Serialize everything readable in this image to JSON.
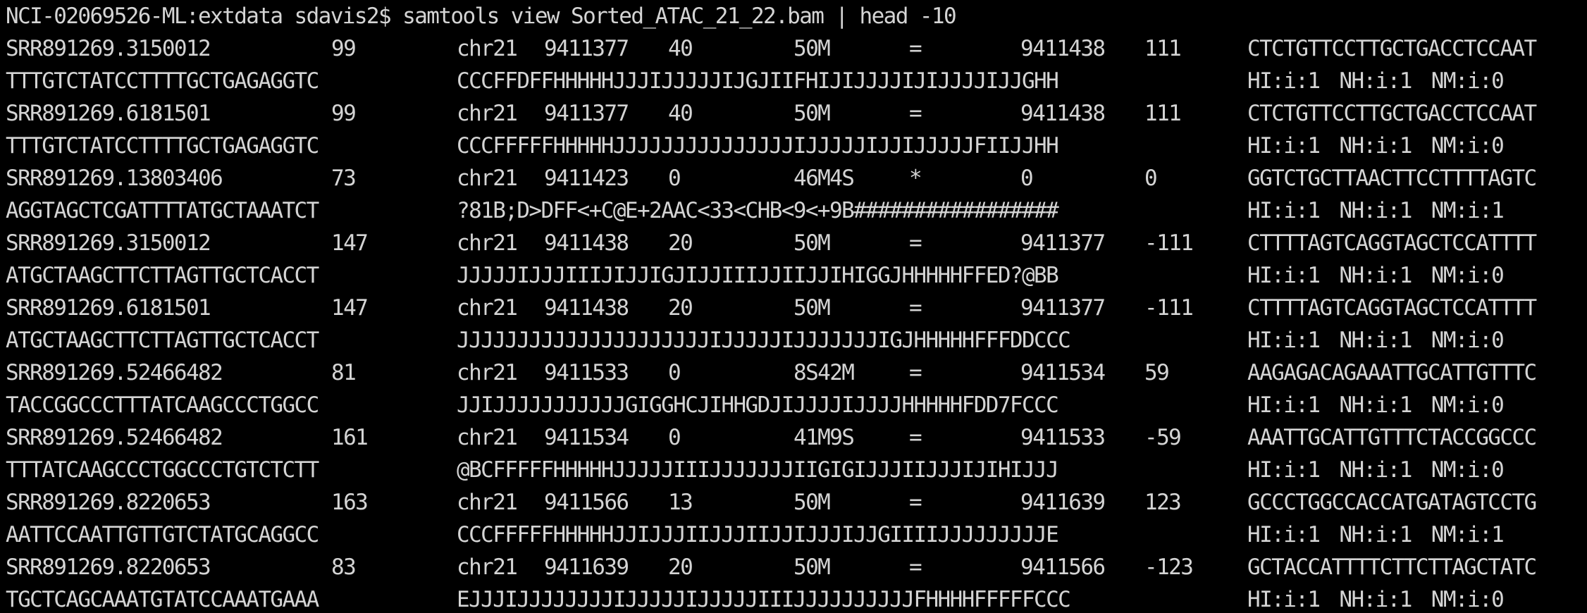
{
  "terminal": {
    "prompt": "NCI-02069526-ML:extdata sdavis2$",
    "command": "samtools view Sorted_ATAC_21_22.bam | head -10",
    "colors": {
      "background": "#000000",
      "text": "#d4d4d4"
    }
  },
  "records": [
    {
      "qname": "SRR891269.3150012",
      "flag": "99",
      "rname": "chr21",
      "pos": "9411377",
      "mapq": "40",
      "cigar": "50M",
      "rnext": "=",
      "pnext": "9411438",
      "tlen": "111",
      "seq_part1": "CTCTGTTCCTTGCTGACCTCCAAT",
      "seq_part2": "TTTGTCTATCCTTTTGCTGAGAGGTC",
      "qual": "CCCFFDFFHHHHHJJJIJJJJJIJGJIIFHIJIJJJJIJIJJJJIJJGHH",
      "tags": [
        "HI:i:1",
        "NH:i:1",
        "NM:i:0"
      ]
    },
    {
      "qname": "SRR891269.6181501",
      "flag": "99",
      "rname": "chr21",
      "pos": "9411377",
      "mapq": "40",
      "cigar": "50M",
      "rnext": "=",
      "pnext": "9411438",
      "tlen": "111",
      "seq_part1": "CTCTGTTCCTTGCTGACCTCCAAT",
      "seq_part2": "TTTGTCTATCCTTTTGCTGAGAGGTC",
      "qual": "CCCFFFFFHHHHHJJJJJJJJJJJJJJJIJJJJJIJJIJJJJJFIIJJHH",
      "tags": [
        "HI:i:1",
        "NH:i:1",
        "NM:i:0"
      ]
    },
    {
      "qname": "SRR891269.13803406",
      "flag": "73",
      "rname": "chr21",
      "pos": "9411423",
      "mapq": "0",
      "cigar": "46M4S",
      "rnext": "*",
      "pnext": "0",
      "tlen": "0",
      "seq_part1": "GGTCTGCTTAACTTCCTTTTAGTC",
      "seq_part2": "AGGTAGCTCGATTTTATGCTAAATCT",
      "qual": "?81B;D>DFF<+C@E+2AAC<33<CHB<9<+9B#################",
      "tags": [
        "HI:i:1",
        "NH:i:1",
        "NM:i:1"
      ]
    },
    {
      "qname": "SRR891269.3150012",
      "flag": "147",
      "rname": "chr21",
      "pos": "9411438",
      "mapq": "20",
      "cigar": "50M",
      "rnext": "=",
      "pnext": "9411377",
      "tlen": "-111",
      "seq_part1": "CTTTTAGTCAGGTAGCTCCATTTT",
      "seq_part2": "ATGCTAAGCTTCTTAGTTGCTCACCT",
      "qual": "JJJJJIJJJIIIJIJJIGJIJJIIIJJIIJJIHIGGJHHHHHFFED?@BB",
      "tags": [
        "HI:i:1",
        "NH:i:1",
        "NM:i:0"
      ]
    },
    {
      "qname": "SRR891269.6181501",
      "flag": "147",
      "rname": "chr21",
      "pos": "9411438",
      "mapq": "20",
      "cigar": "50M",
      "rnext": "=",
      "pnext": "9411377",
      "tlen": "-111",
      "seq_part1": "CTTTTAGTCAGGTAGCTCCATTTT",
      "seq_part2": "ATGCTAAGCTTCTTAGTTGCTCACCT",
      "qual": "JJJJJJJJJJJJJJJJJJJJJIJJJJJIJJJJJJJIGJHHHHHFFFDDCCC",
      "tags": [
        "HI:i:1",
        "NH:i:1",
        "NM:i:0"
      ]
    },
    {
      "qname": "SRR891269.52466482",
      "flag": "81",
      "rname": "chr21",
      "pos": "9411533",
      "mapq": "0",
      "cigar": "8S42M",
      "rnext": "=",
      "pnext": "9411534",
      "tlen": "59",
      "seq_part1": "AAGAGACAGAAATTGCATTGTTTC",
      "seq_part2": "TACCGGCCCTTTATCAAGCCCTGGCC",
      "qual": "JJIJJJJJJJJJJJGIGGHCJIHHGDJIJJJJIJJJJHHHHHFDD7FCCC",
      "tags": [
        "HI:i:1",
        "NH:i:1",
        "NM:i:0"
      ]
    },
    {
      "qname": "SRR891269.52466482",
      "flag": "161",
      "rname": "chr21",
      "pos": "9411534",
      "mapq": "0",
      "cigar": "41M9S",
      "rnext": "=",
      "pnext": "9411533",
      "tlen": "-59",
      "seq_part1": "AAATTGCATTGTTTCTACCGGCCC",
      "seq_part2": "TTTATCAAGCCCTGGCCCTGTCTCTT",
      "qual": "@BCFFFFFHHHHHJJJJJIIIJJJJJJJIIGIGIJJJIIJJJIJIHIJJJ",
      "tags": [
        "HI:i:1",
        "NH:i:1",
        "NM:i:0"
      ]
    },
    {
      "qname": "SRR891269.8220653",
      "flag": "163",
      "rname": "chr21",
      "pos": "9411566",
      "mapq": "13",
      "cigar": "50M",
      "rnext": "=",
      "pnext": "9411639",
      "tlen": "123",
      "seq_part1": "GCCCTGGCCACCATGATAGTCCTG",
      "seq_part2": "AATTCCAATTGTTGTCTATGCAGGCC",
      "qual": "CCCFFFFFHHHHHJJIJJJIIJJJIIJJIJJJIJJGIIIIJJJJJJJJJE",
      "tags": [
        "HI:i:1",
        "NH:i:1",
        "NM:i:1"
      ]
    },
    {
      "qname": "SRR891269.8220653",
      "flag": "83",
      "rname": "chr21",
      "pos": "9411639",
      "mapq": "20",
      "cigar": "50M",
      "rnext": "=",
      "pnext": "9411566",
      "tlen": "-123",
      "seq_part1": "GCTACCATTTTCTTCTTAGCTATC",
      "seq_part2": "TGCTCAGCAAATGTATCCAAATGAAA",
      "qual": "EJJJIJJJJJJJJIJJJJJIJJJJJIIIJJJJJJJJJJFHHHHFFFFFCCC",
      "tags": [
        "HI:i:1",
        "NH:i:1",
        "NM:i:0"
      ]
    }
  ]
}
